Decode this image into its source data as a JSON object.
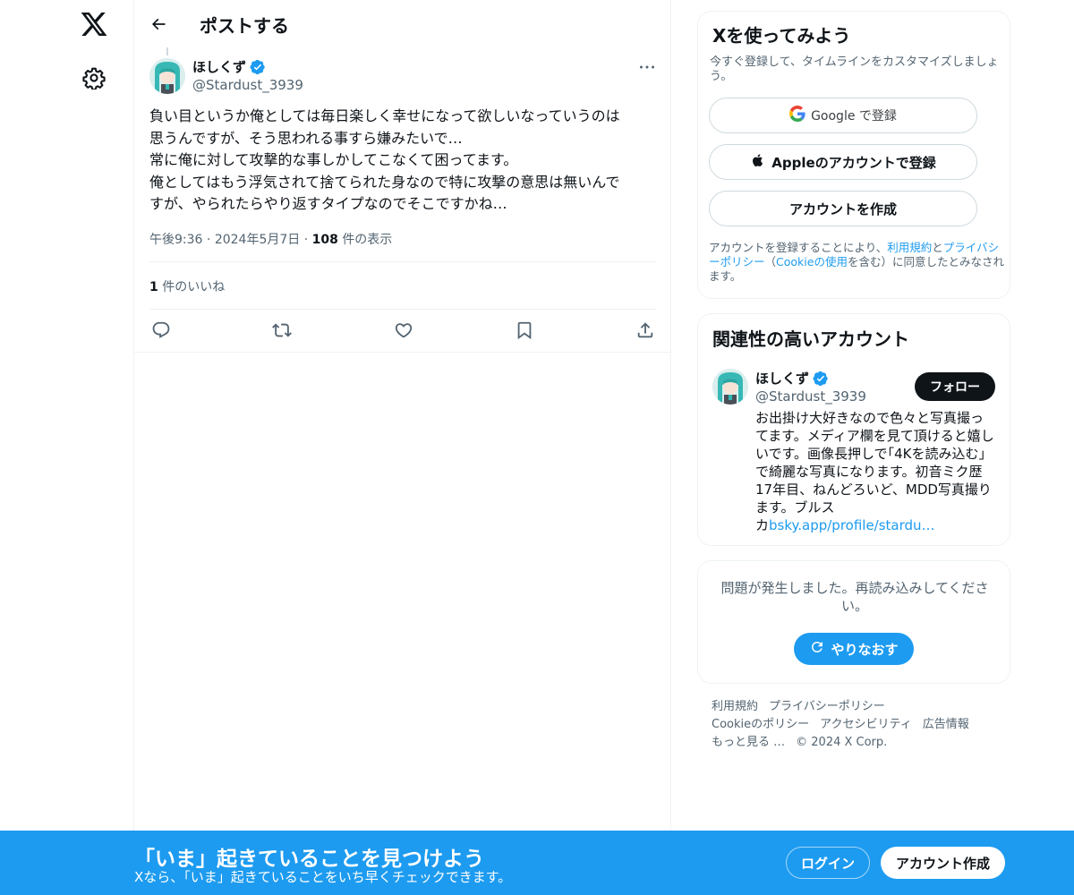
{
  "header": {
    "title": "ポストする"
  },
  "post": {
    "author_name": "ほしくず",
    "author_handle": "@Stardust_3939",
    "lines": [
      "負い目というか俺としては毎日楽しく幸せになって欲しいなっていうのは",
      "思うんですが、そう思われる事すら嫌みたいで…",
      "常に俺に対して攻撃的な事しかしてこなくて困ってます。",
      "俺としてはもう浮気されて捨てられた身なので特に攻撃の意思は無いんで",
      "すが、やられたらやり返すタイプなのでそこですかね…"
    ],
    "time": "午後9:36",
    "date": "2024年5月7日",
    "sep": "·",
    "views_count": "108",
    "views_label": "件の表示",
    "likes_count": "1",
    "likes_label": "件のいいね"
  },
  "signup": {
    "title": "Xを使ってみよう",
    "subtitle": "今すぐ登録して、タイムラインをカスタマイズしましょう。",
    "google_label": "Google で登録",
    "apple_label": "Appleのアカウントで登録",
    "create_label": "アカウントを作成",
    "terms_pre": "アカウントを登録することにより、",
    "terms_link": "利用規約",
    "terms_and": "と",
    "privacy_link": "プライバシーポリシー",
    "terms_mid": "（",
    "cookie_link": "Cookieの使用",
    "terms_post": "を含む）に同意したとみなされます。"
  },
  "related": {
    "title": "関連性の高いアカウント",
    "name": "ほしくず",
    "handle": "@Stardust_3939",
    "follow_label": "フォロー",
    "bio_lines": [
      "お出掛け大好きなので色々と写真撮っ",
      "てます。メディア欄を見て頂けると嬉し",
      "いです。画像長押しで｢4Kを読み込む｣",
      "で綺麗な写真になります。初音ミク歴",
      "17年目、ねんどろいど、MDD写真撮り",
      "ます。ブルス"
    ],
    "bio_last_prefix": "カ",
    "bio_link": "bsky.app/profile/stardu…"
  },
  "error": {
    "message": "問題が発生しました。再読み込みしてください。",
    "retry_label": "やりなおす"
  },
  "footer": {
    "terms": "利用規約",
    "privacy": "プライバシーポリシー",
    "cookie": "Cookieのポリシー",
    "accessibility": "アクセシビリティ",
    "ads": "広告情報",
    "more": "もっと見る …",
    "copyright": "© 2024 X Corp."
  },
  "banner": {
    "title": "「いま」起きていることを見つけよう",
    "subtitle": "Xなら、「いま」起きていることをいち早くチェックできます。",
    "login_label": "ログイン",
    "signup_label": "アカウント作成"
  },
  "colors": {
    "accent": "#1d9bf0",
    "text": "#0f1419",
    "muted": "#536471",
    "border": "#eff3f4"
  },
  "icons": [
    "x-logo-icon",
    "gear-icon",
    "back-arrow-icon",
    "verified-badge-icon",
    "more-icon",
    "reply-icon",
    "repost-icon",
    "like-icon",
    "bookmark-icon",
    "share-icon",
    "google-icon",
    "apple-icon",
    "refresh-icon"
  ]
}
